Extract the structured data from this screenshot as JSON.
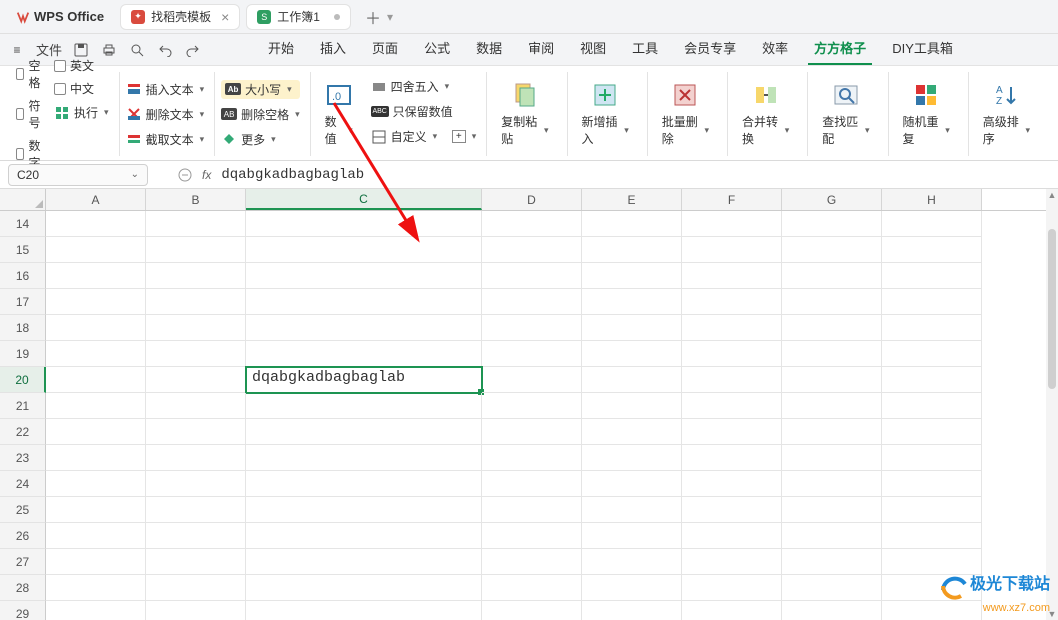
{
  "app": {
    "name": "WPS Office"
  },
  "tabs": [
    {
      "label": "找稻壳模板",
      "color": "#d94b3e"
    },
    {
      "label": "工作簿1",
      "color": "#2f9e62"
    }
  ],
  "file_menu_label": "文件",
  "menus": [
    "开始",
    "插入",
    "页面",
    "公式",
    "数据",
    "审阅",
    "视图",
    "工具",
    "会员专享",
    "效率",
    "方方格子",
    "DIY工具箱"
  ],
  "active_menu_index": 10,
  "ribbon": {
    "grp1": {
      "blank": "空格",
      "english": "英文",
      "symbol": "符号",
      "chinese": "中文",
      "number": "数字",
      "execute": "执行"
    },
    "grp2": {
      "insertText": "插入文本",
      "deleteText": "删除文本",
      "extractText": "截取文本"
    },
    "grp3": {
      "case": "大小写",
      "delSpace": "删除空格",
      "more": "更多"
    },
    "grp4": {
      "value": "数值",
      "round": "四舍五入",
      "keepNum": "只保留数值",
      "custom": "自定义"
    },
    "big": {
      "copypaste": "复制粘贴",
      "newins": "新增插入",
      "batchdel": "批量删除",
      "merge": "合并转换",
      "find": "查找匹配",
      "rand": "随机重复",
      "sort": "高级排序"
    }
  },
  "namebox": "C20",
  "fx_label": "fx",
  "formula": "dqabgkadbagbaglab",
  "columns": [
    "A",
    "B",
    "C",
    "D",
    "E",
    "F",
    "G",
    "H"
  ],
  "rows_start": 14,
  "rows_end": 29,
  "active_cell": {
    "row": 20,
    "col": "C",
    "value": "dqabgkadbagbaglab"
  },
  "watermark": {
    "line1": "极光下载站",
    "line2": "www.xz7.com"
  }
}
